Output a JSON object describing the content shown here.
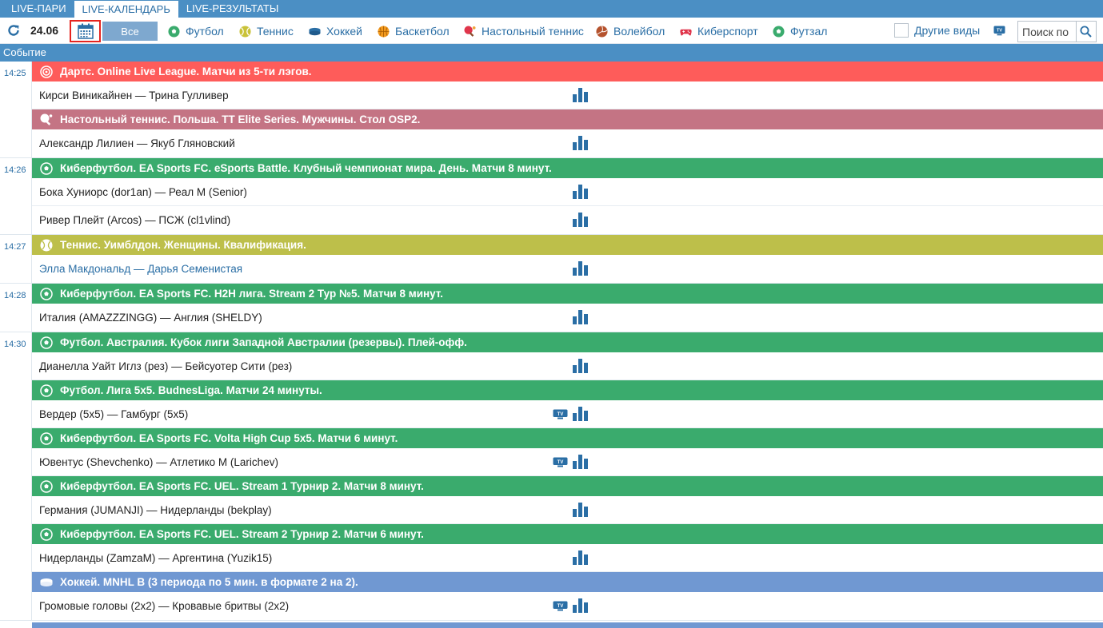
{
  "tabs": [
    {
      "label": "LIVE-ПАРИ",
      "active": false
    },
    {
      "label": "LIVE-КАЛЕНДАРЬ",
      "active": true
    },
    {
      "label": "LIVE-РЕЗУЛЬТАТЫ",
      "active": false
    }
  ],
  "filters": {
    "date": "24.06",
    "all_label": "Все",
    "sports": [
      {
        "label": "Футбол",
        "icon": "football-icon"
      },
      {
        "label": "Теннис",
        "icon": "tennis-icon"
      },
      {
        "label": "Хоккей",
        "icon": "hockey-icon"
      },
      {
        "label": "Баскетбол",
        "icon": "basketball-icon"
      },
      {
        "label": "Настольный теннис",
        "icon": "table-tennis-icon"
      },
      {
        "label": "Волейбол",
        "icon": "volleyball-icon"
      },
      {
        "label": "Киберспорт",
        "icon": "gamepad-icon"
      },
      {
        "label": "Футзал",
        "icon": "futsal-icon"
      }
    ],
    "other_label": "Другие виды",
    "search_placeholder": "Поиск по"
  },
  "header": {
    "column_label": "Событие"
  },
  "colors": {
    "tab_bar": "#4b8fc4",
    "darts": "#fe5c5a",
    "table_tennis": "#c47484",
    "football": "#3aab6d",
    "tennis": "#bdbf4a",
    "hockey": "#7098d2",
    "highlight_border": "#e6241f"
  },
  "blocks": [
    {
      "time": "14:25",
      "groups": [
        {
          "league": "Дартс. Online Live League. Матчи из 5-ти лэгов.",
          "color": "red",
          "icon": "darts-icon",
          "events": [
            {
              "teams": "Кирси Виникайнен — Трина Гулливер",
              "tv": false,
              "link": false
            }
          ]
        },
        {
          "league": "Настольный теннис. Польша. TT Elite Series. Мужчины. Стол OSP2.",
          "color": "rose",
          "icon": "table-tennis-icon",
          "events": [
            {
              "teams": "Александр Лилиен — Якуб Гляновский",
              "tv": false,
              "link": false
            }
          ]
        }
      ]
    },
    {
      "time": "14:26",
      "groups": [
        {
          "league": "Киберфутбол. EA Sports FC. eSports Battle. Клубный чемпионат мира. День. Матчи 8 минут.",
          "color": "green",
          "icon": "football-icon",
          "events": [
            {
              "teams": "Бока Хуниорс (dor1an) — Реал М (Senior)",
              "tv": false,
              "link": false
            },
            {
              "teams": "Ривер Плейт (Arcos) — ПСЖ (cl1vlind)",
              "tv": false,
              "link": false
            }
          ]
        }
      ]
    },
    {
      "time": "14:27",
      "groups": [
        {
          "league": "Теннис. Уимблдон. Женщины. Квалификация.",
          "color": "olive",
          "icon": "tennis-icon",
          "events": [
            {
              "teams": "Элла Макдональд — Дарья Семенистая",
              "tv": false,
              "link": true
            }
          ]
        }
      ]
    },
    {
      "time": "14:28",
      "groups": [
        {
          "league": "Киберфутбол. EA Sports FC. H2H лига. Stream 2 Тур №5. Матчи 8 минут.",
          "color": "green",
          "icon": "football-icon",
          "events": [
            {
              "teams": "Италия (AMAZZZINGG) — Англия (SHELDY)",
              "tv": false,
              "link": false
            }
          ]
        }
      ]
    },
    {
      "time": "14:30",
      "groups": [
        {
          "league": "Футбол. Австралия. Кубок лиги Западной Австралии (резервы). Плей-офф.",
          "color": "green",
          "icon": "football-icon",
          "events": [
            {
              "teams": "Дианелла Уайт Иглз (рез) — Бейсуотер Сити (рез)",
              "tv": false,
              "link": false
            }
          ]
        },
        {
          "league": "Футбол. Лига 5х5. BudnesLiga. Матчи 24 минуты.",
          "color": "green",
          "icon": "football-icon",
          "events": [
            {
              "teams": "Вердер (5х5) — Гамбург (5х5)",
              "tv": true,
              "link": false
            }
          ]
        },
        {
          "league": "Киберфутбол. EA Sports FC. Volta High Cup 5х5. Матчи 6 минут.",
          "color": "green",
          "icon": "football-icon",
          "events": [
            {
              "teams": "Ювентус (Shevchenko) — Атлетико М (Larichev)",
              "tv": true,
              "link": false
            }
          ]
        },
        {
          "league": "Киберфутбол. EA Sports FC. UEL. Stream 1 Турнир 2. Матчи 8 минут.",
          "color": "green",
          "icon": "football-icon",
          "events": [
            {
              "teams": "Германия (JUMANJI) — Нидерланды (bekplay)",
              "tv": false,
              "link": false
            }
          ]
        },
        {
          "league": "Киберфутбол. EA Sports FC. UEL. Stream 2 Турнир 2. Матчи 6 минут.",
          "color": "green",
          "icon": "football-icon",
          "events": [
            {
              "teams": "Нидерланды (ZamzaM) — Аргентина (Yuzik15)",
              "tv": false,
              "link": false
            }
          ]
        },
        {
          "league": "Хоккей. MNHL B (3 периода по 5 мин. в формате 2 на 2).",
          "color": "blue",
          "icon": "hockey-icon",
          "events": [
            {
              "teams": "Громовые головы (2х2) — Кровавые бритвы (2х2)",
              "tv": true,
              "link": false
            }
          ]
        }
      ]
    }
  ]
}
